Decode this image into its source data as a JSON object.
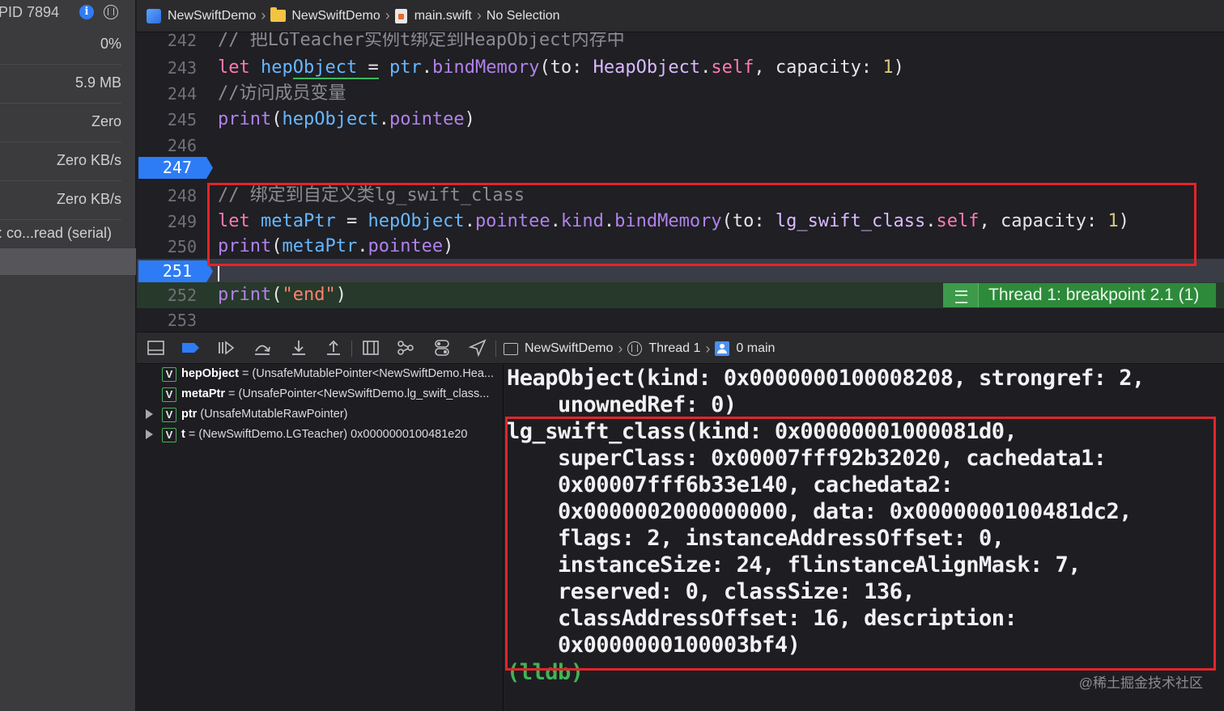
{
  "navigator": {
    "pid": "PID 7894",
    "cpu": "0%",
    "memory": "5.9 MB",
    "energy": "Zero",
    "disk": "Zero KB/s",
    "network": "Zero KB/s",
    "queue": ": co...read (serial)"
  },
  "jumpbar": {
    "project": "NewSwiftDemo",
    "folder": "NewSwiftDemo",
    "file": "main.swift",
    "selection": "No Selection"
  },
  "editor": {
    "lines": [
      {
        "num": "242",
        "text": "// 把LGTeacher实例t绑定到HeapObject内存中"
      },
      {
        "num": "243",
        "text": "let hepObject = ptr.bindMemory(to: HeapObject.self, capacity: 1)"
      },
      {
        "num": "244",
        "text": "//访问成员变量"
      },
      {
        "num": "245",
        "text": "print(hepObject.pointee)"
      },
      {
        "num": "246",
        "text": ""
      },
      {
        "num": "247",
        "text": ""
      },
      {
        "num": "248",
        "text": "// 绑定到自定义类lg_swift_class"
      },
      {
        "num": "249",
        "text": "let metaPtr = hepObject.pointee.kind.bindMemory(to: lg_swift_class.self, capacity: 1)"
      },
      {
        "num": "250",
        "text": "print(metaPtr.pointee)"
      },
      {
        "num": "251",
        "text": ""
      },
      {
        "num": "252",
        "text": "print(\"end\")"
      },
      {
        "num": "253",
        "text": ""
      }
    ],
    "breakpoint_badge": "Thread 1: breakpoint 2.1 (1)"
  },
  "debugbar": {
    "target": "NewSwiftDemo",
    "thread": "Thread 1",
    "frame": "0 main"
  },
  "variables": [
    {
      "name": "hepObject",
      "value": "= (UnsafeMutablePointer<NewSwiftDemo.Hea...",
      "expandable": false
    },
    {
      "name": "metaPtr",
      "value": "= (UnsafePointer<NewSwiftDemo.lg_swift_class...",
      "expandable": false
    },
    {
      "name": "ptr",
      "value": "(UnsafeMutableRawPointer)",
      "expandable": true
    },
    {
      "name": "t",
      "value": "= (NewSwiftDemo.LGTeacher) 0x0000000100481e20",
      "expandable": true
    }
  ],
  "console": {
    "lines": [
      "HeapObject(kind: 0x0000000100008208, strongref: 2,",
      "    unownedRef: 0)",
      "lg_swift_class(kind: 0x00000001000081d0,",
      "    superClass: 0x00007fff92b32020, cachedata1:",
      "    0x00007fff6b33e140, cachedata2:",
      "    0x0000002000000000, data: 0x0000000100481dc2,",
      "    flags: 2, instanceAddressOffset: 0,",
      "    instanceSize: 24, flinstanceAlignMask: 7,",
      "    reserved: 0, classSize: 136,",
      "    classAddressOffset: 16, description:",
      "    0x0000000100003bf4)"
    ],
    "prompt": "(lldb)"
  },
  "watermark": "@稀土掘金技术社区",
  "colors": {
    "breakpoint": "#2d7cf5",
    "highlight_box": "#e0262b",
    "exec_line": "#2e8a3b",
    "comment": "#8b8b92",
    "keyword": "#ff7ab2",
    "string": "#ff8170"
  }
}
